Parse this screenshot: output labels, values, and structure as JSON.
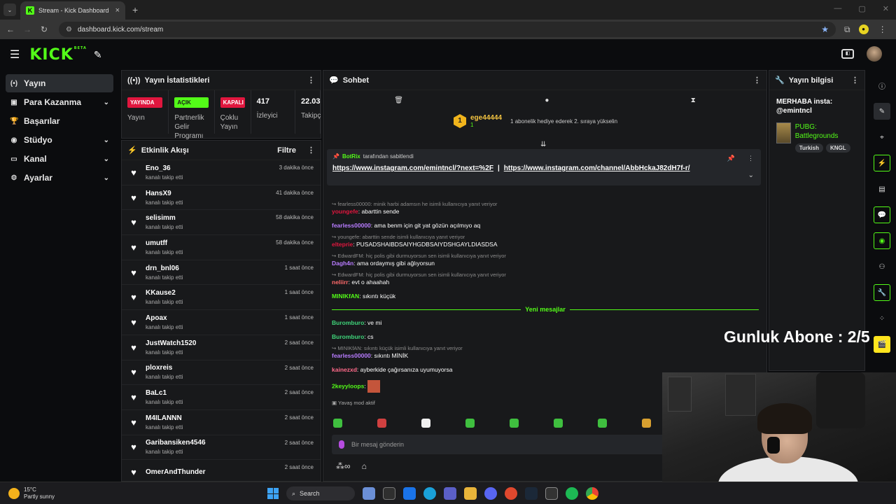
{
  "browser": {
    "tab_title": "Stream - Kick Dashboard",
    "url": "dashboard.kick.com/stream"
  },
  "header": {
    "logo": "KICK",
    "beta": "BETA"
  },
  "sidebar": {
    "items": [
      {
        "label": "Yayın",
        "icon": "broadcast-icon",
        "active": true,
        "chevron": false
      },
      {
        "label": "Para Kazanma",
        "icon": "money-icon",
        "chevron": true
      },
      {
        "label": "Başarılar",
        "icon": "trophy-icon",
        "chevron": false
      },
      {
        "label": "Stüdyo",
        "icon": "studio-icon",
        "chevron": true
      },
      {
        "label": "Kanal",
        "icon": "channel-icon",
        "chevron": true
      },
      {
        "label": "Ayarlar",
        "icon": "gear-icon",
        "chevron": true
      }
    ]
  },
  "stats": {
    "title": "Yayın İstatistikleri",
    "items": [
      {
        "badge": "YAYINDA",
        "label": "Yayın",
        "color": "#e0163e"
      },
      {
        "badge": "AÇIK",
        "label": "Partnerlik Gelir Programı",
        "color": "#53fc18"
      },
      {
        "badge": "KAPALI",
        "label": "Çoklu Yayın",
        "color": "#e0163e"
      },
      {
        "value": "417",
        "label": "İzleyici"
      },
      {
        "value": "22.03",
        "label": "Takipç"
      }
    ]
  },
  "activity": {
    "title": "Etkinlik Akışı",
    "filter": "Filtre",
    "items": [
      {
        "name": "Eno_36",
        "sub": "kanalı takip etti",
        "time": "3 dakika önce"
      },
      {
        "name": "HansX9",
        "sub": "kanalı takip etti",
        "time": "41 dakika önce"
      },
      {
        "name": "selisimm",
        "sub": "kanalı takip etti",
        "time": "58 dakika önce"
      },
      {
        "name": "umutff",
        "sub": "kanalı takip etti",
        "time": "58 dakika önce"
      },
      {
        "name": "drn_bnl06",
        "sub": "kanalı takip etti",
        "time": "1 saat önce"
      },
      {
        "name": "KKause2",
        "sub": "kanalı takip etti",
        "time": "1 saat önce"
      },
      {
        "name": "Apoax",
        "sub": "kanalı takip etti",
        "time": "1 saat önce"
      },
      {
        "name": "JustWatch1520",
        "sub": "kanalı takip etti",
        "time": "2 saat önce"
      },
      {
        "name": "ploxreis",
        "sub": "kanalı takip etti",
        "time": "2 saat önce"
      },
      {
        "name": "BaLc1",
        "sub": "kanalı takip etti",
        "time": "2 saat önce"
      },
      {
        "name": "M4ILANNN",
        "sub": "kanalı takip etti",
        "time": "2 saat önce"
      },
      {
        "name": "Garibansiken4546",
        "sub": "kanalı takip etti",
        "time": "2 saat önce"
      },
      {
        "name": "OmerAndThunder",
        "sub": "",
        "time": "2 saat önce"
      }
    ]
  },
  "chat": {
    "title": "Sohbet",
    "hype": {
      "rank": "1",
      "name": "ege44444",
      "count": "1",
      "message": "1 abonelik hediye ederek 2. sıraya yükselin"
    },
    "pinned": {
      "by": "BotRix",
      "suffix": "tarafından sabitlendi",
      "link1": "https://www.instagram.com/emintncl/?next=%2F",
      "sep": "|",
      "link2": "https://www.instagram.com/channel/AbbHckaJ82dH7f-r/"
    },
    "messages": [
      {
        "reply": "fearless00000: minik harbi adamsın he isimli kullanıcıya yanıt veriyor",
        "user": "youngefe",
        "color": "#e0163e",
        "text": "abarttin sende"
      },
      {
        "user": "fearless00000",
        "color": "#b87cff",
        "text": "ama benm için git yat gözün açılmıyo aq"
      },
      {
        "reply": "youngefe: abarttin sende isimli kullanıcıya yanıt veriyor",
        "user": "elteprie",
        "color": "#e0163e",
        "text": "PUSADSHAIBDSAIYHGDBSAIYDSHGAYLDIASDSA"
      },
      {
        "reply": "EdwardFM: hiç polis gibi durmuyorsun sen isimli kullanıcıya yanıt veriyor",
        "user": "Dagh4n",
        "color": "#b87cff",
        "text": "ama ordaymış gibi ağlıyorsun"
      },
      {
        "reply": "EdwardFM: hiç polis gibi durmuyorsun sen isimli kullanıcıya yanıt veriyor",
        "user": "neliirr",
        "color": "#ff6a6a",
        "text": "evt o ahaahah"
      },
      {
        "user": "MINIKfAN",
        "color": "#53fc18",
        "text": "sıkıntı küçük"
      }
    ],
    "new_label": "Yeni mesajlar",
    "messages2": [
      {
        "user": "Buromburo",
        "color": "#3fd47a",
        "text": "ve mi"
      },
      {
        "user": "Buromburo",
        "color": "#3fd47a",
        "text": "cs"
      },
      {
        "reply": "MINIKfAN: sıkıntı küçük isimli kullanıcıya yanıt veriyor",
        "user": "fearless00000",
        "color": "#b87cff",
        "text": "sıkıntı MİNİK"
      },
      {
        "user": "kainezxd",
        "color": "#ff6a8a",
        "text": "ayberkide çağırsanıza uyumuyorsa"
      },
      {
        "user": "2keyyloops",
        "color": "#53fc18",
        "text": ""
      }
    ],
    "slow_mode": "Yavaş mod aktif",
    "placeholder": "Bir mesaj gönderin"
  },
  "stream_info": {
    "title": "Yayın bilgisi",
    "stream_title": "MERHABA insta: @emintncl",
    "game": "PUBG: Battlegrounds",
    "tags": [
      "Turkish",
      "KNGL"
    ]
  },
  "overlay": {
    "text": "Gunluk Abone : 2/5"
  },
  "taskbar": {
    "temp": "15°C",
    "weather": "Partly sunny",
    "search": "Search"
  },
  "colors": {
    "brand": "#53fc18",
    "live": "#e0163e",
    "bg": "#0b0c0e",
    "panel": "#18191b"
  }
}
